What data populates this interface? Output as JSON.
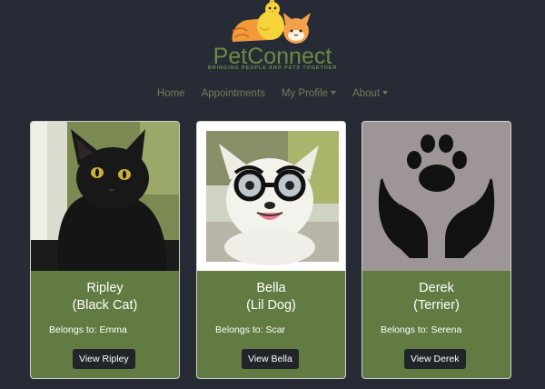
{
  "brand": {
    "name": "PetConnect",
    "tagline": "BRINGING PEOPLE AND PETS TOGETHER",
    "logo_icon": "cat-and-chick-logo"
  },
  "nav": {
    "items": [
      {
        "label": "Home",
        "dropdown": false
      },
      {
        "label": "Appointments",
        "dropdown": false
      },
      {
        "label": "My Profile",
        "dropdown": true
      },
      {
        "label": "About",
        "dropdown": true
      }
    ]
  },
  "colors": {
    "page_background": "#272b35",
    "card_body": "#627b42",
    "nav_text": "#6f7f58",
    "button": "#212529"
  },
  "pets": [
    {
      "name": "Ripley",
      "kind": "(Black Cat)",
      "owner_label": "Belongs to: Emma",
      "button_label": "View Ripley",
      "image_icon": "black-cat-photo"
    },
    {
      "name": "Bella",
      "kind": "(Lil Dog)",
      "owner_label": "Belongs to: Scar",
      "button_label": "View Bella",
      "image_icon": "dog-with-glasses-photo"
    },
    {
      "name": "Derek",
      "kind": "(Terrier)",
      "owner_label": "Belongs to: Serena",
      "button_label": "View Derek",
      "image_icon": "paw-in-hands-icon"
    }
  ]
}
